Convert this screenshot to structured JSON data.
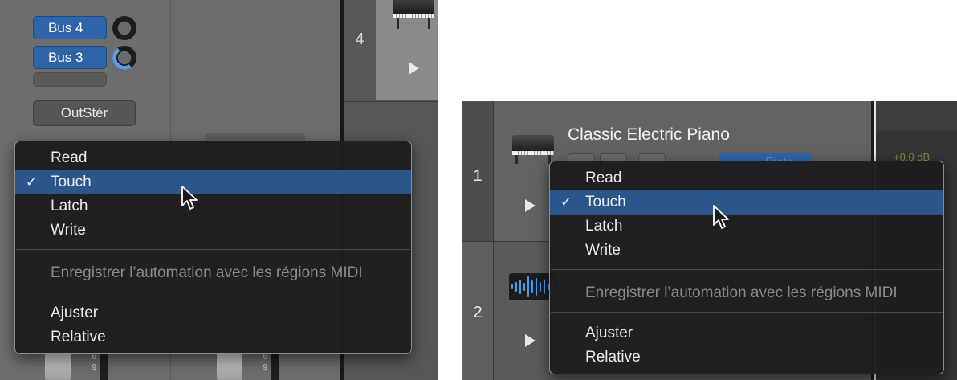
{
  "left_panel": {
    "sends": [
      {
        "label": "Bus 4"
      },
      {
        "label": "Bus 3"
      }
    ],
    "output_label": "OutStér",
    "track_number": "4",
    "fader_scale": [
      "6",
      "9"
    ]
  },
  "right_panel": {
    "tracks": [
      {
        "number": "1",
        "name": "Classic Electric Piano"
      },
      {
        "number": "2"
      }
    ],
    "gain_label": "+0,0 dB",
    "partial_button_label": "Piste"
  },
  "automation_menu": {
    "mode_items": [
      {
        "label": "Read",
        "checked": false
      },
      {
        "label": "Touch",
        "checked": true
      },
      {
        "label": "Latch",
        "checked": false
      },
      {
        "label": "Write",
        "checked": false
      }
    ],
    "option_item": {
      "label": "Enregistrer l’automation avec les régions MIDI",
      "enabled": false
    },
    "extra_items": [
      {
        "label": "Ajuster"
      },
      {
        "label": "Relative"
      }
    ],
    "check_glyph": "✓"
  },
  "colors": {
    "accent_blue": "#2e65a8",
    "menu_highlight": "#2c5689",
    "menu_background": "#1e1e20",
    "knob_indicator": "#5b9be8"
  },
  "icons": [
    "piano-icon",
    "play-icon",
    "waveform-icon",
    "pointer-cursor-icon",
    "checkmark-icon"
  ]
}
